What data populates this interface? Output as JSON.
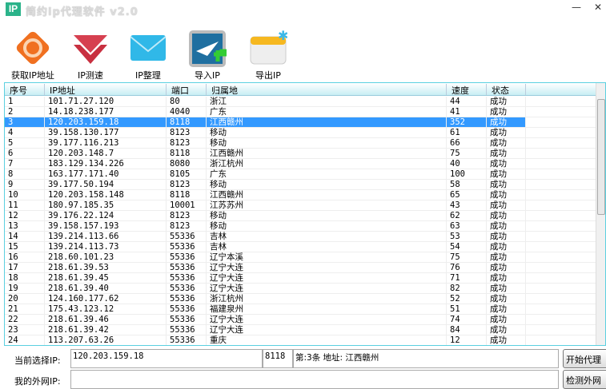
{
  "window": {
    "logo": "IP",
    "title": "简约ip代理软件 v2.0",
    "minimize": "—",
    "close": "✕"
  },
  "toolbar": [
    {
      "label": "获取IP地址",
      "icon": "refresh-icon"
    },
    {
      "label": "IP测速",
      "icon": "speed-test-icon"
    },
    {
      "label": "IP整理",
      "icon": "envelope-icon"
    },
    {
      "label": "导入IP",
      "icon": "import-icon"
    },
    {
      "label": "导出IP",
      "icon": "export-icon"
    }
  ],
  "table": {
    "columns": [
      "序号",
      "IP地址",
      "端口",
      "归属地",
      "速度",
      "状态"
    ],
    "selected_index": 2,
    "rows": [
      [
        "1",
        "101.71.27.120",
        "80",
        "浙江",
        "44",
        "成功"
      ],
      [
        "2",
        "14.18.238.177",
        "4040",
        "广东",
        "41",
        "成功"
      ],
      [
        "3",
        "120.203.159.18",
        "8118",
        "江西赣州",
        "352",
        "成功"
      ],
      [
        "4",
        "39.158.130.177",
        "8123",
        "移动",
        "61",
        "成功"
      ],
      [
        "5",
        "39.177.116.213",
        "8123",
        "移动",
        "66",
        "成功"
      ],
      [
        "6",
        "120.203.148.7",
        "8118",
        "江西赣州",
        "75",
        "成功"
      ],
      [
        "7",
        "183.129.134.226",
        "8080",
        "浙江杭州",
        "40",
        "成功"
      ],
      [
        "8",
        "163.177.171.40",
        "8105",
        "广东",
        "100",
        "成功"
      ],
      [
        "9",
        "39.177.50.194",
        "8123",
        "移动",
        "58",
        "成功"
      ],
      [
        "10",
        "120.203.158.148",
        "8118",
        "江西赣州",
        "65",
        "成功"
      ],
      [
        "11",
        "180.97.185.35",
        "10001",
        "江苏苏州",
        "43",
        "成功"
      ],
      [
        "12",
        "39.176.22.124",
        "8123",
        "移动",
        "62",
        "成功"
      ],
      [
        "13",
        "39.158.157.193",
        "8123",
        "移动",
        "63",
        "成功"
      ],
      [
        "14",
        "139.214.113.66",
        "55336",
        "吉林",
        "53",
        "成功"
      ],
      [
        "15",
        "139.214.113.73",
        "55336",
        "吉林",
        "54",
        "成功"
      ],
      [
        "16",
        "218.60.101.23",
        "55336",
        "辽宁本溪",
        "75",
        "成功"
      ],
      [
        "17",
        "218.61.39.53",
        "55336",
        "辽宁大连",
        "76",
        "成功"
      ],
      [
        "18",
        "218.61.39.45",
        "55336",
        "辽宁大连",
        "71",
        "成功"
      ],
      [
        "19",
        "218.61.39.40",
        "55336",
        "辽宁大连",
        "82",
        "成功"
      ],
      [
        "20",
        "124.160.177.62",
        "55336",
        "浙江杭州",
        "52",
        "成功"
      ],
      [
        "21",
        "175.43.123.12",
        "55336",
        "福建泉州",
        "51",
        "成功"
      ],
      [
        "22",
        "218.61.39.46",
        "55336",
        "辽宁大连",
        "74",
        "成功"
      ],
      [
        "23",
        "218.61.39.42",
        "55336",
        "辽宁大连",
        "84",
        "成功"
      ],
      [
        "24",
        "113.207.63.26",
        "55336",
        "重庆",
        "12",
        "成功"
      ]
    ]
  },
  "bottom": {
    "current_label": "当前选择IP:",
    "current_ip": "120.203.159.18",
    "current_port": "8118",
    "current_info": "第:3条  地址: 江西赣州",
    "start_button": "开始代理",
    "external_label": "我的外网IP:",
    "external_ip": "",
    "check_button": "检测外网"
  }
}
